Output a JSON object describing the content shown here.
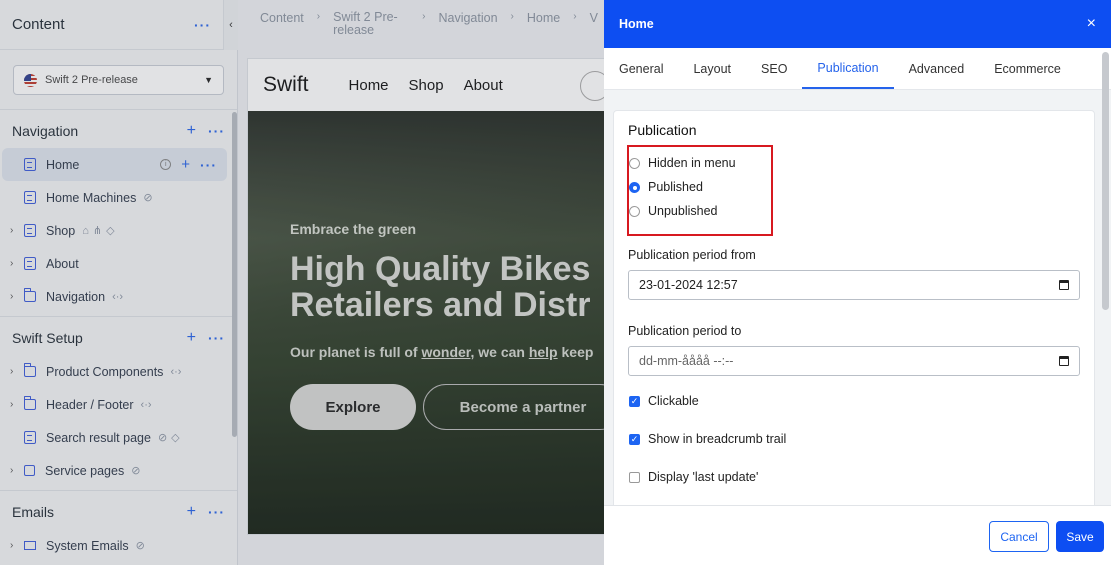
{
  "sidebar": {
    "title": "Content",
    "site_selector": "Swift 2 Pre-release",
    "sections": [
      {
        "label": "Navigation",
        "items": [
          {
            "label": "Home"
          },
          {
            "label": "Home Machines"
          },
          {
            "label": "Shop"
          },
          {
            "label": "About"
          },
          {
            "label": "Navigation"
          }
        ]
      },
      {
        "label": "Swift Setup",
        "items": [
          {
            "label": "Product Components"
          },
          {
            "label": "Header / Footer"
          },
          {
            "label": "Search result page"
          },
          {
            "label": "Service pages"
          }
        ]
      },
      {
        "label": "Emails",
        "items": [
          {
            "label": "System Emails"
          }
        ]
      }
    ]
  },
  "breadcrumb": [
    "Content",
    "Swift 2 Pre-release",
    "Navigation",
    "Home",
    "V"
  ],
  "preview": {
    "logo": "Swift",
    "nav": [
      "Home",
      "Shop",
      "About"
    ],
    "eyebrow": "Embrace the green",
    "headline_1": "High Quality Bikes",
    "headline_2": "Retailers and Distr",
    "subtitle_1": "Our planet is full of ",
    "subtitle_link_1": "wonder",
    "subtitle_2": ", we can ",
    "subtitle_link_2": "help",
    "subtitle_3": " keep",
    "btn_explore": "Explore",
    "btn_partner": "Become a partner"
  },
  "modal": {
    "title": "Home",
    "close": "×",
    "tabs": [
      "General",
      "Layout",
      "SEO",
      "Publication",
      "Advanced",
      "Ecommerce"
    ],
    "active_tab": "Publication",
    "panel_title": "Publication",
    "radios": [
      {
        "label": "Hidden in menu",
        "checked": false
      },
      {
        "label": "Published",
        "checked": true
      },
      {
        "label": "Unpublished",
        "checked": false
      }
    ],
    "period_from_label": "Publication period from",
    "period_from_value": "23-01-2024 12:57",
    "period_to_label": "Publication period to",
    "period_to_placeholder": "dd-mm-åååå --:--",
    "checks": [
      {
        "label": "Clickable",
        "checked": true
      },
      {
        "label": "Show in breadcrumb trail",
        "checked": true
      },
      {
        "label": "Display 'last update'",
        "checked": false
      }
    ],
    "cancel": "Cancel",
    "save": "Save"
  },
  "colors": {
    "accent": "#0d4ef2",
    "highlight_border": "#d71920"
  }
}
